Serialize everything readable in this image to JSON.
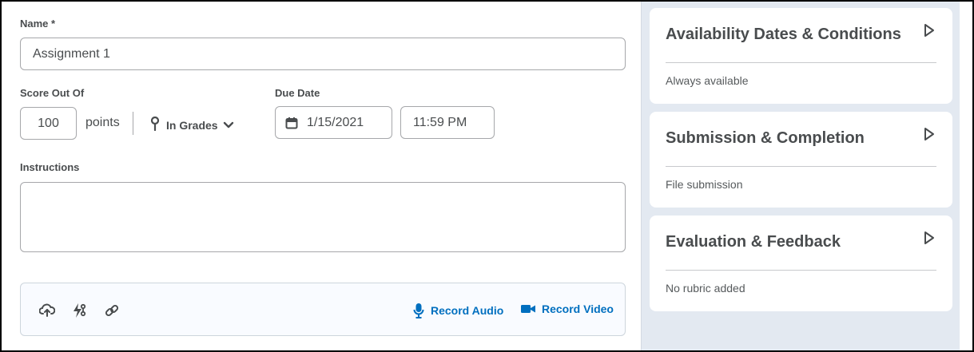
{
  "form": {
    "name_label": "Name *",
    "name_value": "Assignment 1",
    "score_label": "Score Out Of",
    "score_value": "100",
    "points_label": "points",
    "grades_label": "In Grades",
    "due_date_label": "Due Date",
    "due_date_value": "1/15/2021",
    "due_time_value": "11:59 PM",
    "instructions_label": "Instructions",
    "instructions_value": ""
  },
  "toolbar": {
    "icons": [
      "upload-icon",
      "tools-icon",
      "link-icon"
    ],
    "record_audio_label": "Record Audio",
    "record_video_label": "Record Video",
    "accent_color": "#006fbf"
  },
  "side_panel": {
    "cards": [
      {
        "title": "Availability Dates & Conditions",
        "summary": "Always available"
      },
      {
        "title": "Submission & Completion",
        "summary": "File submission"
      },
      {
        "title": "Evaluation & Feedback",
        "summary": "No rubric added"
      }
    ]
  }
}
